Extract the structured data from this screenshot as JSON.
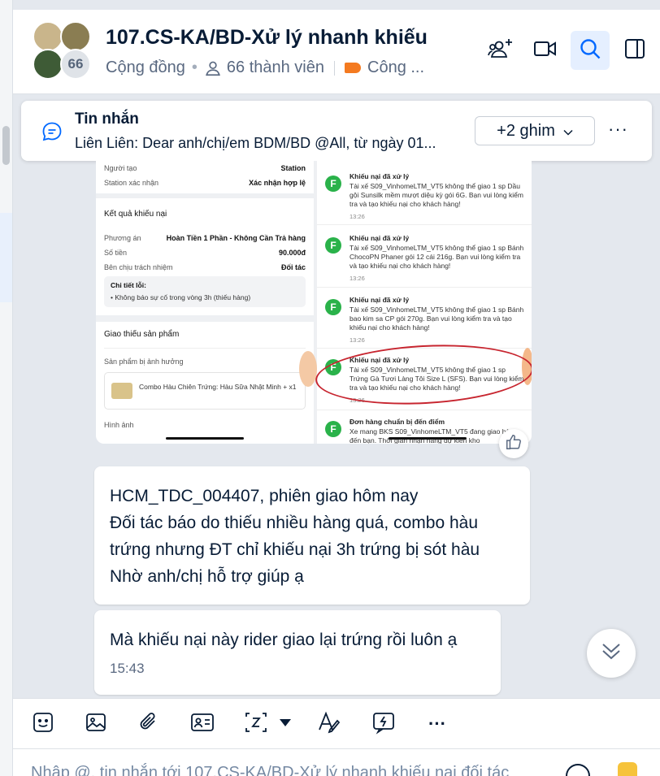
{
  "header": {
    "title": "107.CS-KA/BD-Xử lý nhanh khiếu",
    "community_label": "Cộng đồng",
    "members_label": "66 thành viên",
    "tag_label": "Công ...",
    "member_badge": "66",
    "icons": [
      "add-member-icon",
      "video-call-icon",
      "search-icon",
      "sidebar-toggle-icon"
    ]
  },
  "pinned": {
    "title": "Tin nhắn",
    "preview": "Liên Liên: Dear anh/chị/em BDM/BD @All, từ ngày 01...",
    "pin_count_label": "+2 ghim",
    "more_label": "···"
  },
  "screenshot": {
    "left": {
      "row_creator_label": "Người tạo",
      "row_creator_value": "Station",
      "row_confirm_label": "Station xác nhận",
      "row_confirm_value": "Xác nhận hợp lệ",
      "result_title": "Kết quả khiếu nại",
      "plan_label": "Phương án",
      "plan_value": "Hoàn Tiền 1 Phần - Không Cần Trả hàng",
      "amount_label": "Số tiền",
      "amount_value": "90.000đ",
      "party_label": "Bên chịu trách nhiệm",
      "party_value": "Đối tác",
      "error_title": "Chi tiết lỗi:",
      "error_text": "• Không báo sự cố trong vòng 3h (thiếu hàng)",
      "missing_title": "Giao thiếu sản phẩm",
      "affected_label": "Sản phẩm bị ảnh hưởng",
      "product_text": "Combo Hàu Chiên Trứng: Hàu Sữa Nhật Minh + x1",
      "image_label": "Hình ảnh"
    },
    "notifications": [
      {
        "title": "Khiếu nại đã xử lý",
        "body": "Tài xế S09_VinhomeLTM_VT5 không thể giao 1 sp Dầu gội Sunsilk mềm mượt diệu kỳ gói 6G. Bạn vui lòng kiểm tra và tạo khiếu nại cho khách hàng!",
        "time": "13:26"
      },
      {
        "title": "Khiếu nại đã xử lý",
        "body": "Tài xế S09_VinhomeLTM_VT5 không thể giao 1 sp Bánh ChocoPN Phaner gói 12 cái 216g. Bạn vui lòng kiểm tra và tạo khiếu nại cho khách hàng!",
        "time": "13:26"
      },
      {
        "title": "Khiếu nại đã xử lý",
        "body": "Tài xế S09_VinhomeLTM_VT5 không thể giao 1 sp Bánh bao kim sa CP gói 270g. Bạn vui lòng kiểm tra và tạo khiếu nại cho khách hàng!",
        "time": "13:26"
      },
      {
        "title": "Khiếu nại đã xử lý",
        "body": "Tài xế S09_VinhomeLTM_VT5 không thể giao 1 sp Trứng Gà Tươi Làng Tôi Size L (SFS). Bạn vui lòng kiểm tra và tạo khiếu nại cho khách hàng!",
        "time": "13:26"
      },
      {
        "title": "Đơn hàng chuẩn bị đến điểm",
        "body": "Xe mang BKS S09_VinhomeLTM_VT5 đang giao hàng đến bạn. Thời gian nhận hàng dự kiến kho",
        "time": ""
      }
    ],
    "badge_letter": "F"
  },
  "messages": [
    {
      "lines": [
        "HCM_TDC_004407, phiên giao hôm nay",
        "Đối tác báo do thiếu nhiều hàng quá, combo hàu",
        "trứng nhưng ĐT chỉ khiếu nại 3h trứng bị sót hàu",
        "Nhờ anh/chị hỗ trợ giúp ạ"
      ]
    },
    {
      "lines": [
        "Mà khiếu nại này rider giao lại trứng rồi luôn ạ"
      ],
      "time": "15:43"
    }
  ],
  "toolbar": {
    "icons": [
      "sticker-icon",
      "image-icon",
      "attachment-icon",
      "contact-card-icon",
      "screenshot-icon",
      "dropdown-arrow-icon",
      "format-text-icon",
      "quick-message-icon",
      "more-icon"
    ],
    "more_label": "···"
  },
  "composer": {
    "placeholder": "Nhập @, tin nhắn tới 107.CS-KA/BD-Xử lý nhanh khiếu nại đối tác"
  },
  "colors": {
    "accent": "#0068ff",
    "tag": "#f47a20",
    "highlight_circle": "#c7252f",
    "app_green": "#2ab24a"
  }
}
